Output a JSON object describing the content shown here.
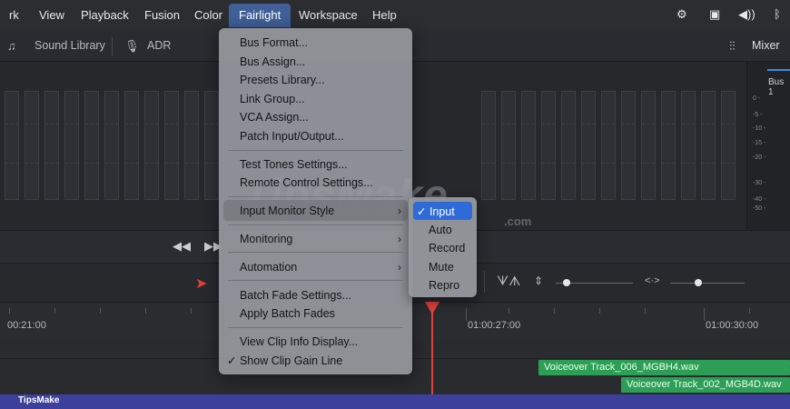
{
  "menubar": {
    "items": [
      "rk",
      "View",
      "Playback",
      "Fusion",
      "Color",
      "Fairlight",
      "Workspace",
      "Help"
    ],
    "active": "Fairlight"
  },
  "toolbar": {
    "sound_library": "Sound Library",
    "adr": "ADR",
    "mixer": "Mixer"
  },
  "bus_panel": {
    "label": "Bus 1",
    "scale": [
      "0 -",
      "-5 -",
      "-10 -",
      "-15 -",
      "-20 -",
      "-30 -",
      "-40 -",
      "-50 -"
    ]
  },
  "fairlight_menu": {
    "items": [
      {
        "label": "Bus Format..."
      },
      {
        "label": "Bus Assign..."
      },
      {
        "label": "Presets Library..."
      },
      {
        "label": "Link Group..."
      },
      {
        "label": "VCA Assign..."
      },
      {
        "label": "Patch Input/Output..."
      },
      {
        "label": "Test Tones Settings..."
      },
      {
        "label": "Remote Control Settings..."
      },
      {
        "label": "Input Monitor Style"
      },
      {
        "label": "Monitoring"
      },
      {
        "label": "Automation"
      },
      {
        "label": "Batch Fade Settings..."
      },
      {
        "label": "Apply Batch Fades"
      },
      {
        "label": "View Clip Info Display..."
      },
      {
        "label": "✓ Show Clip Gain Line"
      }
    ]
  },
  "input_monitor_submenu": {
    "items": [
      "✓ Input",
      "Auto",
      "Record",
      "Mute",
      "Repro"
    ],
    "selected": "Input"
  },
  "timeline": {
    "timecodes": [
      "00:21:00",
      "01:00:27:00",
      "01:00:30:00"
    ],
    "clips": [
      "Voiceover Track_006_MGBH4.wav",
      "Voiceover Track_002_MGB4D.wav"
    ]
  },
  "watermark": {
    "text": "TipsMake",
    "suffix": ".com"
  },
  "footer": {
    "brand": "TipsMake"
  },
  "colors": {
    "menu_active": "#3f5f96",
    "submenu_selected": "#2f6bd8",
    "clip": "#2d9e56",
    "playhead": "#e0403a",
    "brand_bar": "#3d3f9c"
  }
}
